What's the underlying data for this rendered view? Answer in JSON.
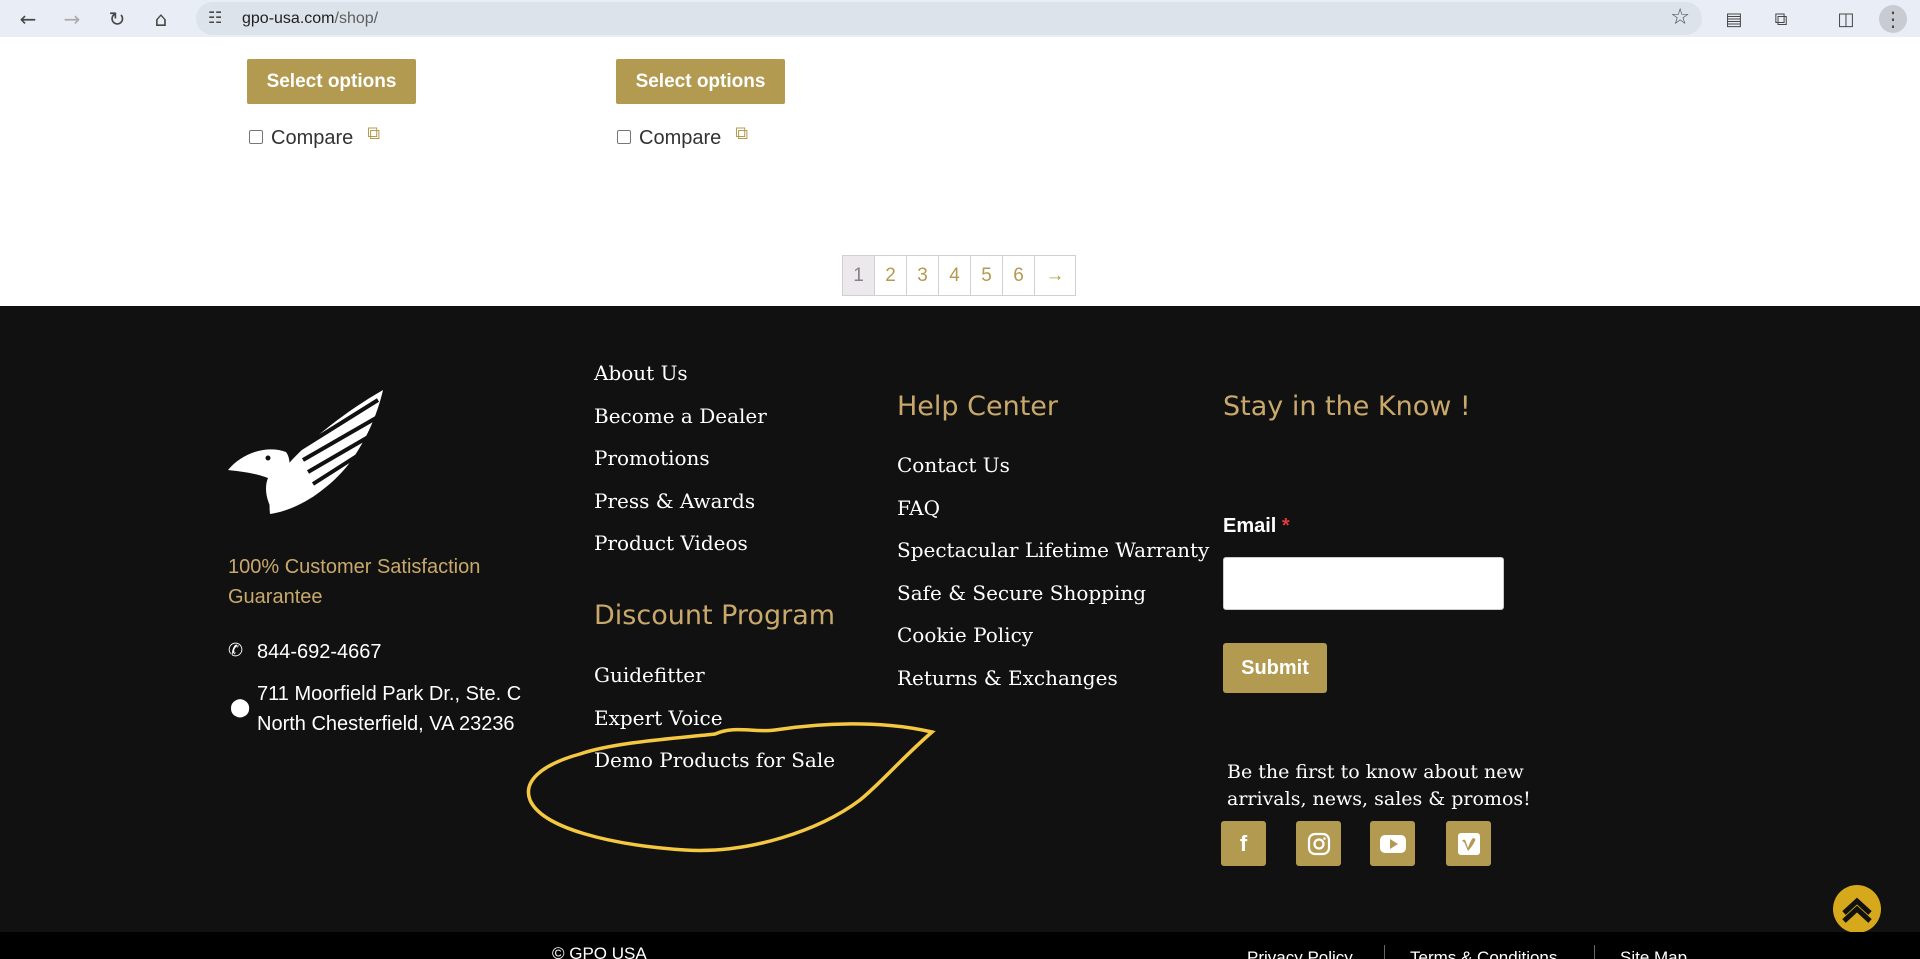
{
  "browser": {
    "url_domain": "gpo-usa.com",
    "url_path": "/shop/"
  },
  "products": {
    "select_label": "Select options",
    "compare_label": "Compare"
  },
  "pagination": {
    "pages": [
      "1",
      "2",
      "3",
      "4",
      "5",
      "6"
    ],
    "current": "1",
    "next": "→"
  },
  "footer": {
    "guarantee": "100% Customer Satisfaction Guarantee",
    "phone": "844-692-4667",
    "address_line1": "711 Moorfield Park Dr., Ste. C",
    "address_line2": "North Chesterfield, VA 23236",
    "col1_links": [
      "About Us",
      "Become a Dealer",
      "Promotions",
      "Press & Awards",
      "Product Videos"
    ],
    "discount_heading": "Discount Program",
    "discount_links": [
      "Guidefitter",
      "Expert Voice",
      "Demo Products for Sale"
    ],
    "help_heading": "Help Center",
    "help_links": [
      "Contact Us",
      "FAQ",
      "Spectacular Lifetime Warranty",
      "Safe & Secure Shopping",
      "Cookie Policy",
      "Returns & Exchanges"
    ],
    "newsletter_heading": "Stay in the Know !",
    "email_label": "Email",
    "required_mark": "*",
    "submit_label": "Submit",
    "tagline": "Be the first to know about new arrivals, news, sales & promos!",
    "social_icons": [
      "facebook-icon",
      "instagram-icon",
      "youtube-icon",
      "vimeo-icon"
    ]
  },
  "bottom_bar": {
    "copyright": "© GPO USA",
    "links": [
      "Privacy Policy",
      "Terms & Conditions",
      "Site Map"
    ]
  },
  "colors": {
    "accent_gold": "#b39a51",
    "heading_gold": "#c9a96b",
    "footer_bg": "#111111",
    "annotation_yellow": "#f5c842",
    "scroll_top": "#d6a81c"
  }
}
